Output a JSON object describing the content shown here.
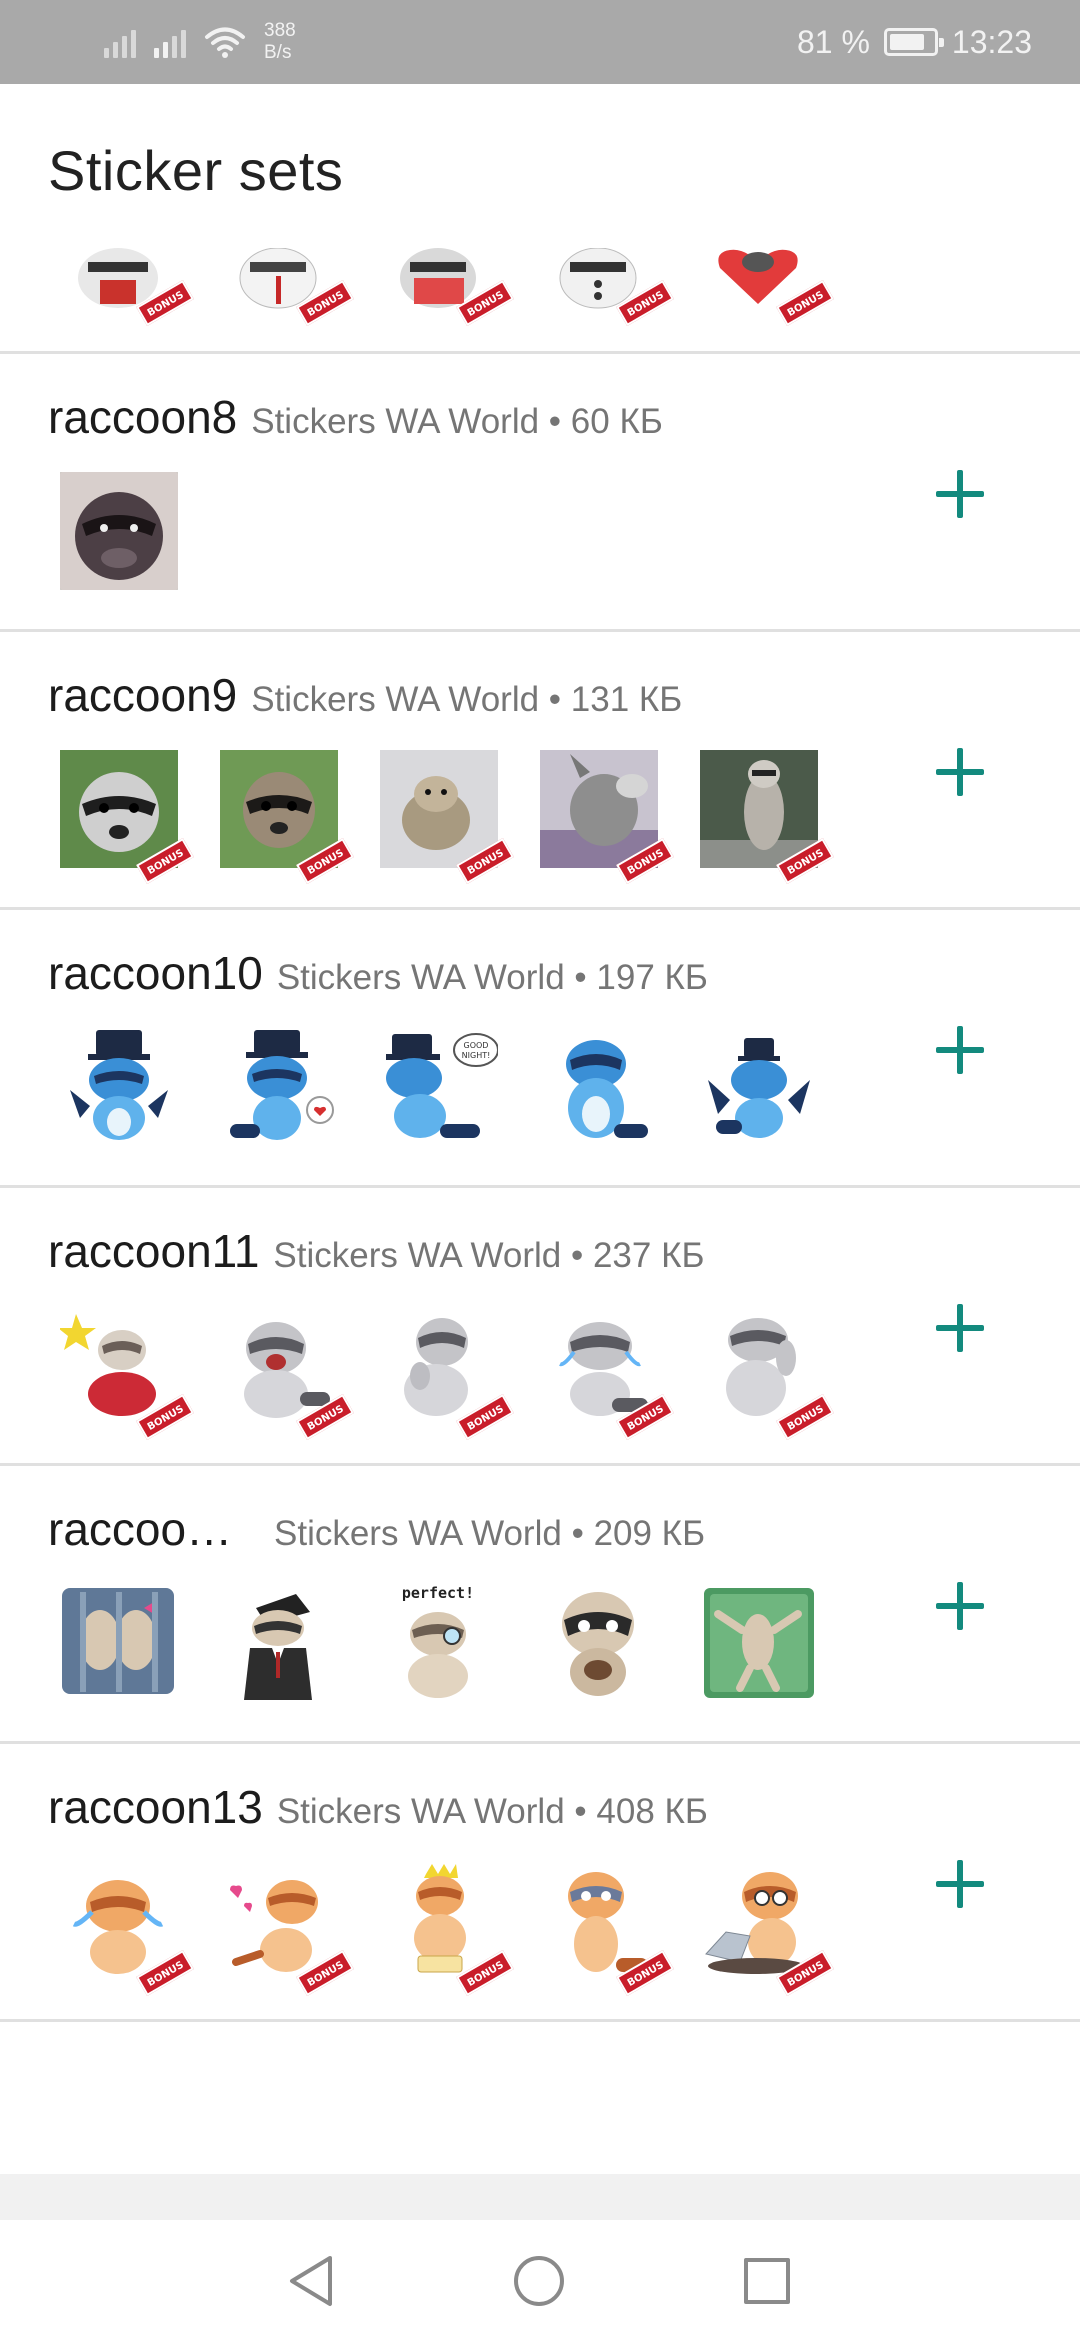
{
  "status_bar": {
    "net_speed_value": "388",
    "net_speed_unit": "B/s",
    "battery_percent": "81 %",
    "battery_level": 0.81,
    "time": "13:23",
    "icons": [
      "signal-icon",
      "signal-icon",
      "wifi-icon",
      "battery-icon"
    ]
  },
  "header": {
    "title": "Sticker sets"
  },
  "sticker_sets": [
    {
      "name": "raccoon8",
      "publisher": "Stickers WA World",
      "separator": "•",
      "size": "60 КБ",
      "style": "photo",
      "add_icon": "plus-icon"
    },
    {
      "name": "raccoon9",
      "publisher": "Stickers WA World",
      "separator": "•",
      "size": "131 КБ",
      "style": "photo-bonus",
      "add_icon": "plus-icon"
    },
    {
      "name": "raccoon10",
      "publisher": "Stickers WA World",
      "separator": "•",
      "size": "197 КБ",
      "style": "blue-cartoon",
      "add_icon": "plus-icon"
    },
    {
      "name": "raccoon11",
      "publisher": "Stickers WA World",
      "separator": "•",
      "size": "237 КБ",
      "style": "grey-cartoon-bonus",
      "add_icon": "plus-icon"
    },
    {
      "name": "raccoo…",
      "publisher": "Stickers WA World",
      "separator": "•",
      "size": "209 КБ",
      "style": "beige-cartoon",
      "add_icon": "plus-icon"
    },
    {
      "name": "raccoon13",
      "publisher": "Stickers WA World",
      "separator": "•",
      "size": "408 КБ",
      "style": "orange-cartoon-bonus",
      "add_icon": "plus-icon"
    }
  ],
  "sticker_badge": "BONUS",
  "colors": {
    "accent": "#138a7e",
    "status_bar": "#a9a9a9",
    "divider": "#e0e0e0"
  },
  "nav_bar": {
    "icons": [
      "back-icon",
      "home-icon",
      "recent-apps-icon"
    ]
  }
}
